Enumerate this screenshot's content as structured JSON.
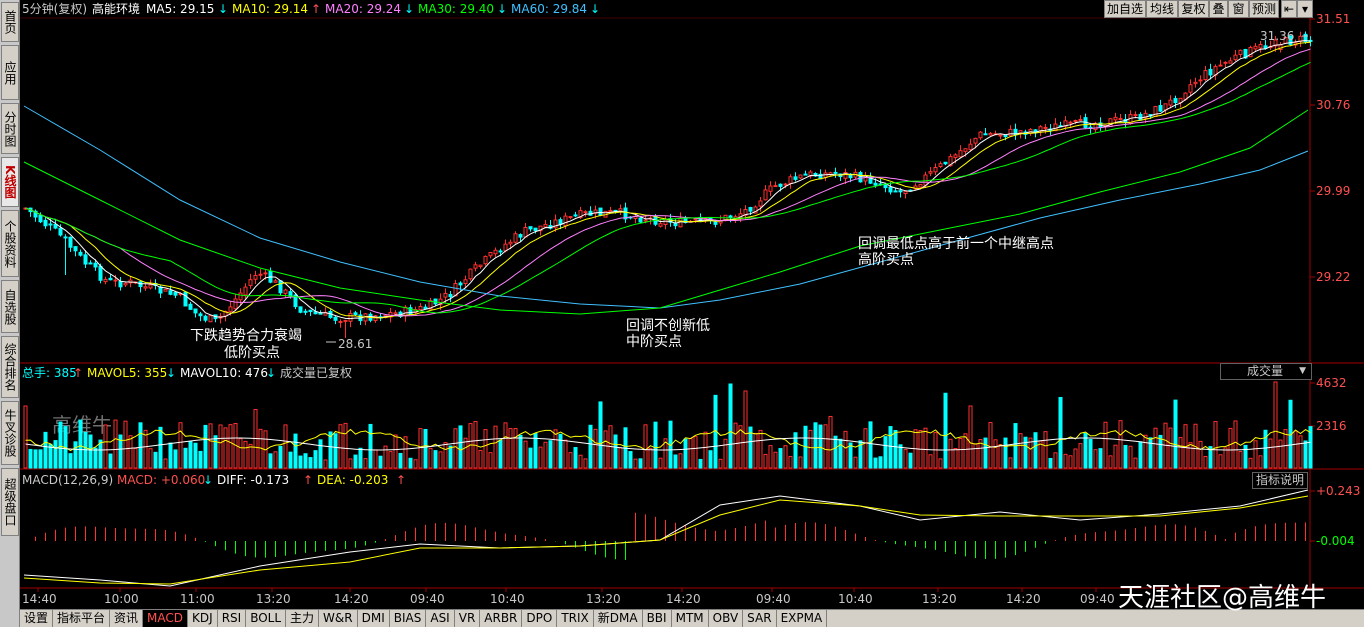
{
  "header": {
    "period": "5分钟(复权)",
    "stock": "高能环境",
    "ma": [
      {
        "label": "MA5: 29.15",
        "arrow": "↓",
        "color": "#ffffff",
        "arrow_color": "#00ffff"
      },
      {
        "label": "MA10: 29.14",
        "arrow": "↑",
        "color": "#ffff00",
        "arrow_color": "#ff5050"
      },
      {
        "label": "MA20: 29.24",
        "arrow": "↓",
        "color": "#ff80ff",
        "arrow_color": "#00ffff"
      },
      {
        "label": "MA30: 29.40",
        "arrow": "↓",
        "color": "#00ff00",
        "arrow_color": "#00ffff"
      },
      {
        "label": "MA60: 29.84",
        "arrow": "↓",
        "color": "#40c0ff",
        "arrow_color": "#00ffff"
      }
    ]
  },
  "toolbar": [
    "加自选",
    "均线",
    "复权",
    "叠",
    "窗",
    "预测"
  ],
  "sidebar": [
    {
      "label": "首页",
      "active": false
    },
    {
      "label": "应用",
      "active": false
    },
    {
      "label": "分时图",
      "active": false
    },
    {
      "label": "K线图",
      "active": true
    },
    {
      "label": "个股资料",
      "active": false
    },
    {
      "label": "自选股",
      "active": false
    },
    {
      "label": "综合排名",
      "active": false
    },
    {
      "label": "牛叉诊股",
      "active": false
    },
    {
      "label": "超级盘口",
      "active": false
    }
  ],
  "price_axis": [
    "31.51",
    "30.76",
    "29.99",
    "29.22"
  ],
  "high_label": "31.36",
  "low_label": "28.61",
  "annotations": [
    {
      "line1": "下跌趋势合力衰竭",
      "line2": "低阶买点"
    },
    {
      "line1": "回调不创新低",
      "line2": "中阶买点"
    },
    {
      "line1": "回调最低点高于前一个中继高点",
      "line2": "高阶买点"
    }
  ],
  "volume": {
    "legend": [
      {
        "label": "总手: 385",
        "arrow": "↑",
        "color": "#00ffff",
        "arrow_color": "#ff5050"
      },
      {
        "label": "MAVOL5: 355",
        "arrow": "↓",
        "color": "#ffff00",
        "arrow_color": "#00ffff"
      },
      {
        "label": "MAVOL10: 476",
        "arrow": "↓",
        "color": "#ffffff",
        "arrow_color": "#00ffff"
      },
      {
        "label": "成交量已复权",
        "arrow": "",
        "color": "#c8c8c8",
        "arrow_color": "#c8c8c8"
      }
    ],
    "selector": "成交量",
    "axis": [
      "4632",
      "2316"
    ],
    "watermark": "高维牛"
  },
  "macd": {
    "legend": [
      {
        "label": "MACD(12,26,9)",
        "arrow": "",
        "color": "#c8c8c8",
        "arrow_color": "#c8c8c8"
      },
      {
        "label": "MACD: +0.060",
        "arrow": "↓",
        "color": "#ff5050",
        "arrow_color": "#00ffff"
      },
      {
        "label": "DIFF: -0.173",
        "arrow": "↑",
        "color": "#ffffff",
        "arrow_color": "#ff5050"
      },
      {
        "label": "DEA: -0.203",
        "arrow": "↑",
        "color": "#ffff00",
        "arrow_color": "#ff5050"
      }
    ],
    "help": "指标说明",
    "axis": [
      "+0.243",
      "-0.004"
    ]
  },
  "time_axis": [
    "14:40",
    "10:00",
    "11:00",
    "13:20",
    "14:20",
    "09:40",
    "10:40",
    "13:20",
    "14:20",
    "09:40",
    "10:40",
    "13:20",
    "14:20",
    "09:40"
  ],
  "tabs": [
    "设置",
    "指标平台",
    "资讯",
    "MACD",
    "KDJ",
    "RSI",
    "BOLL",
    "主力",
    "W&R",
    "DMI",
    "BIAS",
    "ASI",
    "VR",
    "ARBR",
    "DPO",
    "TRIX",
    "新DMA",
    "BBI",
    "MTM",
    "OBV",
    "SAR",
    "EXPMA"
  ],
  "active_tab": "MACD",
  "watermark": "天涯社区@高维牛",
  "colors": {
    "up": "#ff3030",
    "down": "#00ffff",
    "axis": "#a00000",
    "ma5": "#ffffff",
    "ma10": "#ffff00",
    "ma20": "#ff80ff",
    "ma30": "#00ff00",
    "ma60": "#40c0ff"
  }
}
